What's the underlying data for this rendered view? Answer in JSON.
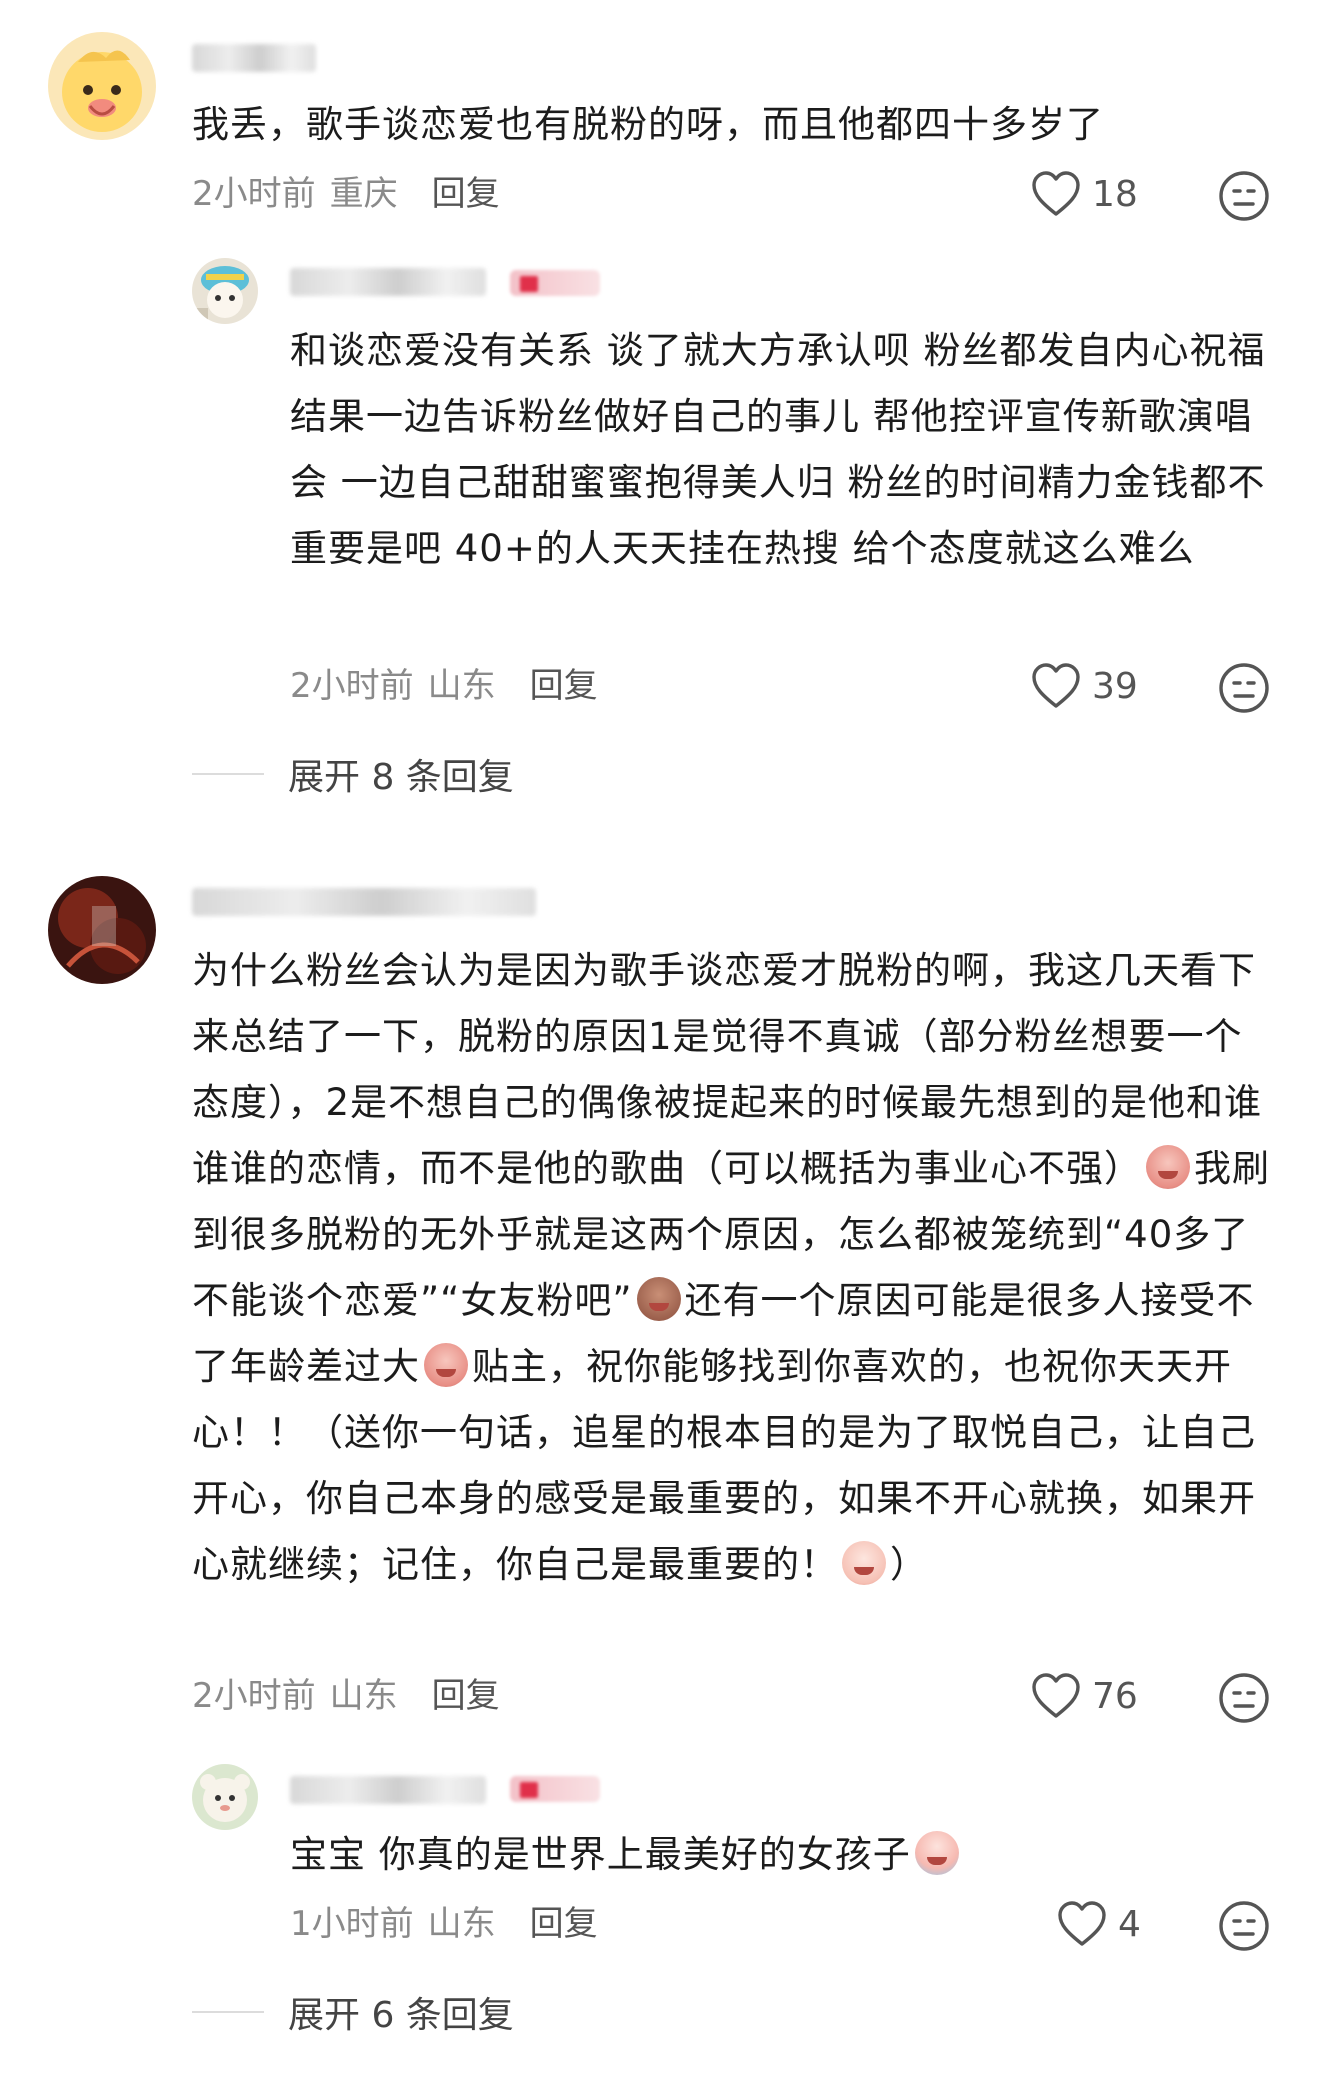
{
  "comments": [
    {
      "id": "c1",
      "avatar": "chick-avatar",
      "text": "我丢，歌手谈恋爱也有脱粉的呀，而且他都四十多岁了",
      "time": "2小时前",
      "location": "重庆",
      "reply_label": "回复",
      "likes": "18",
      "replies": [
        {
          "avatar": "cartoon-avatar",
          "text": "和谈恋爱没有关系 谈了就大方承认呗 粉丝都发自内心祝福 结果一边告诉粉丝做好自己的事儿 帮他控评宣传新歌演唱会 一边自己甜甜蜜蜜抱得美人归 粉丝的时间精力金钱都不重要是吧 40+的人天天挂在热搜 给个态度就这么难么",
          "time": "2小时前",
          "location": "山东",
          "reply_label": "回复",
          "likes": "39"
        }
      ],
      "expand_label": "展开 8 条回复"
    },
    {
      "id": "c2",
      "avatar": "dark-red-avatar",
      "text_parts": [
        "为什么粉丝会认为是因为歌手谈恋爱才脱粉的啊，我这几天看下来总结了一下，脱粉的原因1是觉得不真诚（部分粉丝想要一个态度），2是不想自己的偶像被提起来的时候最先想到的是他和谁谁谁的恋情，而不是他的歌曲（可以概括为事业心不强）",
        "我刷到很多脱粉的无外乎就是这两个原因，怎么都被笼统到“40多了不能谈个恋爱”“女友粉吧”",
        "还有一个原因可能是很多人接受不了年龄差过大",
        "贴主，祝你能够找到你喜欢的，也祝你天天开心！！（送你一句话，追星的根本目的是为了取悦自己，让自己开心，你自己本身的感受是最重要的，如果不开心就换，如果开心就继续；记住，你自己是最重要的！",
        "）"
      ],
      "time": "2小时前",
      "location": "山东",
      "reply_label": "回复",
      "likes": "76",
      "replies": [
        {
          "avatar": "bear-avatar",
          "text": "宝宝 你真的是世界上最美好的女孩子",
          "time": "1小时前",
          "location": "山东",
          "reply_label": "回复",
          "likes": "4"
        }
      ],
      "expand_label": "展开 6 条回复"
    }
  ],
  "colors": {
    "text": "#1c1c1c",
    "meta": "#8a8a8a",
    "icon": "#555555"
  }
}
